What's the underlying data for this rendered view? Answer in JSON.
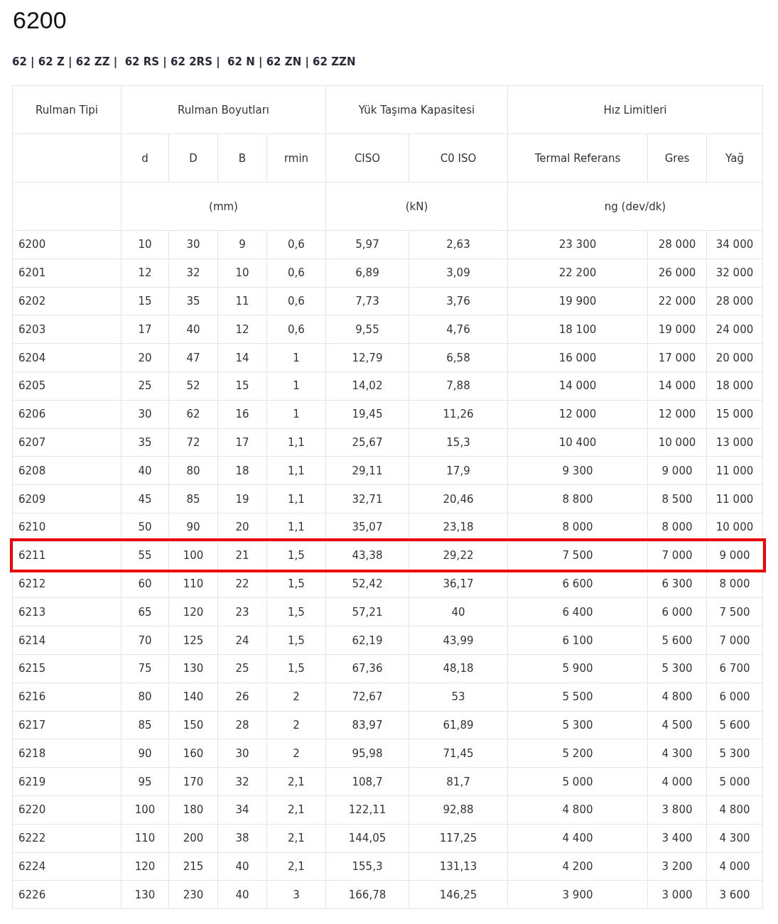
{
  "title": "6200",
  "variants": "62 | 62 Z | 62 ZZ |  62 RS | 62 2RS |  62 N | 62 ZN | 62 ZZN",
  "table": {
    "column_groups": [
      {
        "label": "Rulman Tipi"
      },
      {
        "label": "Rulman Boyutları",
        "unit": "(mm)",
        "columns": [
          "d",
          "D",
          "B",
          "rmin"
        ]
      },
      {
        "label": "Yük Taşıma Kapasitesi",
        "unit": "(kN)",
        "columns": [
          "CISO",
          "C0 ISO"
        ]
      },
      {
        "label": "Hız Limitleri",
        "unit": "ng (dev/dk)",
        "columns": [
          "Termal Referans",
          "Gres",
          "Yağ"
        ]
      }
    ],
    "rows": [
      {
        "cells": [
          "6200",
          "10",
          "30",
          "9",
          "0,6",
          "5,97",
          "2,63",
          "23 300",
          "28 000",
          "34 000"
        ],
        "highlighted": false
      },
      {
        "cells": [
          "6201",
          "12",
          "32",
          "10",
          "0,6",
          "6,89",
          "3,09",
          "22 200",
          "26 000",
          "32 000"
        ],
        "highlighted": false
      },
      {
        "cells": [
          "6202",
          "15",
          "35",
          "11",
          "0,6",
          "7,73",
          "3,76",
          "19 900",
          "22 000",
          "28 000"
        ],
        "highlighted": false
      },
      {
        "cells": [
          "6203",
          "17",
          "40",
          "12",
          "0,6",
          "9,55",
          "4,76",
          "18 100",
          "19 000",
          "24 000"
        ],
        "highlighted": false
      },
      {
        "cells": [
          "6204",
          "20",
          "47",
          "14",
          "1",
          "12,79",
          "6,58",
          "16 000",
          "17 000",
          "20 000"
        ],
        "highlighted": false
      },
      {
        "cells": [
          "6205",
          "25",
          "52",
          "15",
          "1",
          "14,02",
          "7,88",
          "14 000",
          "14 000",
          "18 000"
        ],
        "highlighted": false
      },
      {
        "cells": [
          "6206",
          "30",
          "62",
          "16",
          "1",
          "19,45",
          "11,26",
          "12 000",
          "12 000",
          "15 000"
        ],
        "highlighted": false
      },
      {
        "cells": [
          "6207",
          "35",
          "72",
          "17",
          "1,1",
          "25,67",
          "15,3",
          "10 400",
          "10 000",
          "13 000"
        ],
        "highlighted": false
      },
      {
        "cells": [
          "6208",
          "40",
          "80",
          "18",
          "1,1",
          "29,11",
          "17,9",
          "9 300",
          "9 000",
          "11 000"
        ],
        "highlighted": false
      },
      {
        "cells": [
          "6209",
          "45",
          "85",
          "19",
          "1,1",
          "32,71",
          "20,46",
          "8 800",
          "8 500",
          "11 000"
        ],
        "highlighted": false
      },
      {
        "cells": [
          "6210",
          "50",
          "90",
          "20",
          "1,1",
          "35,07",
          "23,18",
          "8 000",
          "8 000",
          "10 000"
        ],
        "highlighted": false
      },
      {
        "cells": [
          "6211",
          "55",
          "100",
          "21",
          "1,5",
          "43,38",
          "29,22",
          "7 500",
          "7 000",
          "9 000"
        ],
        "highlighted": true
      },
      {
        "cells": [
          "6212",
          "60",
          "110",
          "22",
          "1,5",
          "52,42",
          "36,17",
          "6 600",
          "6 300",
          "8 000"
        ],
        "highlighted": false
      },
      {
        "cells": [
          "6213",
          "65",
          "120",
          "23",
          "1,5",
          "57,21",
          "40",
          "6 400",
          "6 000",
          "7 500"
        ],
        "highlighted": false
      },
      {
        "cells": [
          "6214",
          "70",
          "125",
          "24",
          "1,5",
          "62,19",
          "43,99",
          "6 100",
          "5 600",
          "7 000"
        ],
        "highlighted": false
      },
      {
        "cells": [
          "6215",
          "75",
          "130",
          "25",
          "1,5",
          "67,36",
          "48,18",
          "5 900",
          "5 300",
          "6 700"
        ],
        "highlighted": false
      },
      {
        "cells": [
          "6216",
          "80",
          "140",
          "26",
          "2",
          "72,67",
          "53",
          "5 500",
          "4 800",
          "6 000"
        ],
        "highlighted": false
      },
      {
        "cells": [
          "6217",
          "85",
          "150",
          "28",
          "2",
          "83,97",
          "61,89",
          "5 300",
          "4 500",
          "5 600"
        ],
        "highlighted": false
      },
      {
        "cells": [
          "6218",
          "90",
          "160",
          "30",
          "2",
          "95,98",
          "71,45",
          "5 200",
          "4 300",
          "5 300"
        ],
        "highlighted": false
      },
      {
        "cells": [
          "6219",
          "95",
          "170",
          "32",
          "2,1",
          "108,7",
          "81,7",
          "5 000",
          "4 000",
          "5 000"
        ],
        "highlighted": false
      },
      {
        "cells": [
          "6220",
          "100",
          "180",
          "34",
          "2,1",
          "122,11",
          "92,88",
          "4 800",
          "3 800",
          "4 800"
        ],
        "highlighted": false
      },
      {
        "cells": [
          "6222",
          "110",
          "200",
          "38",
          "2,1",
          "144,05",
          "117,25",
          "4 400",
          "3 400",
          "4 300"
        ],
        "highlighted": false
      },
      {
        "cells": [
          "6224",
          "120",
          "215",
          "40",
          "2,1",
          "155,3",
          "131,13",
          "4 200",
          "3 200",
          "4 000"
        ],
        "highlighted": false
      },
      {
        "cells": [
          "6226",
          "130",
          "230",
          "40",
          "3",
          "166,78",
          "146,25",
          "3 900",
          "3 000",
          "3 600"
        ],
        "highlighted": false
      }
    ]
  }
}
